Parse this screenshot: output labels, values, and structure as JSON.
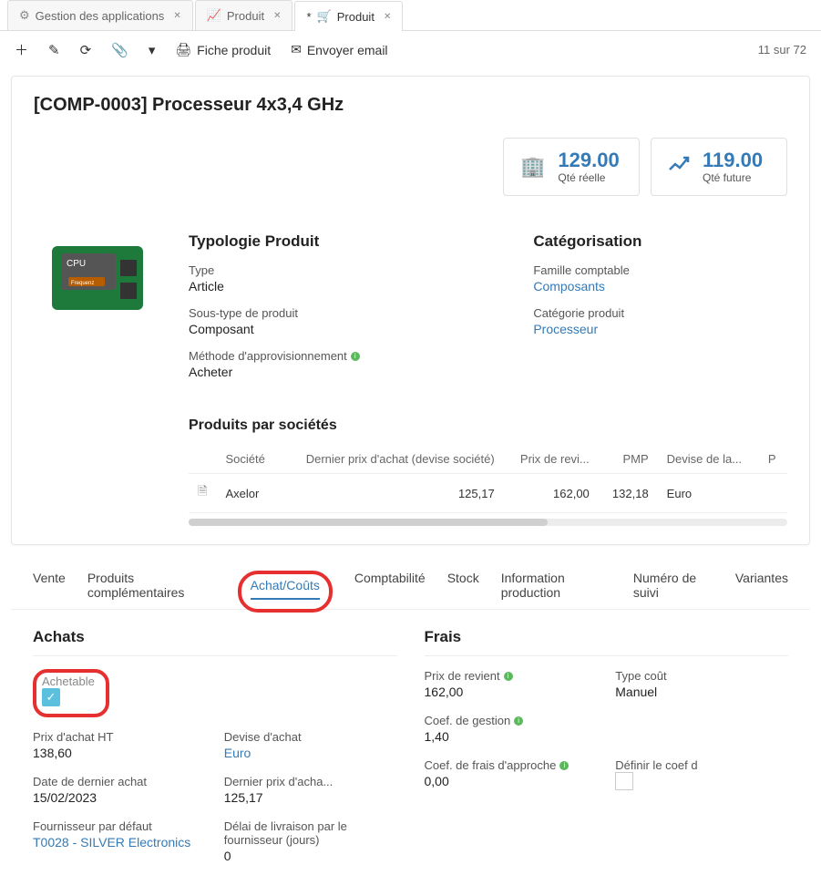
{
  "tabs": [
    {
      "icon": "gear",
      "label": "Gestion des applications"
    },
    {
      "icon": "chart",
      "label": "Produit"
    },
    {
      "icon": "cart",
      "label": "Produit",
      "active": true,
      "dirty": "*"
    }
  ],
  "toolbar": {
    "fiche_label": "Fiche produit",
    "email_label": "Envoyer email",
    "pager": "11 sur 72"
  },
  "header": {
    "title": "[COMP-0003] Processeur 4x3,4 GHz"
  },
  "kpis": [
    {
      "value": "129.00",
      "label": "Qté réelle",
      "icon": "building"
    },
    {
      "value": "119.00",
      "label": "Qté future",
      "icon": "trend"
    }
  ],
  "typologie": {
    "section": "Typologie Produit",
    "type_label": "Type",
    "type_value": "Article",
    "subtype_label": "Sous-type de produit",
    "subtype_value": "Composant",
    "method_label": "Méthode d'approvisionnement",
    "method_value": "Acheter"
  },
  "categorisation": {
    "section": "Catégorisation",
    "fam_label": "Famille comptable",
    "fam_value": "Composants",
    "cat_label": "Catégorie produit",
    "cat_value": "Processeur"
  },
  "company_table": {
    "title": "Produits par sociétés",
    "headers": [
      "Société",
      "Dernier prix d'achat (devise société)",
      "Prix de revi...",
      "PMP",
      "Devise de la...",
      "P"
    ],
    "row": {
      "societe": "Axelor",
      "dernier_prix": "125,17",
      "prix_revient": "162,00",
      "pmp": "132,18",
      "devise": "Euro"
    }
  },
  "subtabs": [
    "Vente",
    "Produits complémentaires",
    "Achat/Coûts",
    "Comptabilité",
    "Stock",
    "Information production",
    "Numéro de suivi",
    "Variantes"
  ],
  "achats": {
    "title": "Achats",
    "achetable_label": "Achetable",
    "prix_ht_label": "Prix d'achat HT",
    "prix_ht_value": "138,60",
    "devise_label": "Devise d'achat",
    "devise_value": "Euro",
    "date_label": "Date de dernier achat",
    "date_value": "15/02/2023",
    "dernier_prix_label": "Dernier prix d'acha...",
    "dernier_prix_value": "125,17",
    "fournisseur_label": "Fournisseur par défaut",
    "fournisseur_value": "T0028 - SILVER Electronics",
    "delai_label": "Délai de livraison par le fournisseur (jours)",
    "delai_value": "0"
  },
  "frais": {
    "title": "Frais",
    "prix_revient_label": "Prix de revient",
    "prix_revient_value": "162,00",
    "type_cout_label": "Type coût",
    "type_cout_value": "Manuel",
    "coef_gestion_label": "Coef. de gestion",
    "coef_gestion_value": "1,40",
    "coef_frais_label": "Coef. de frais d'approche",
    "coef_frais_value": "0,00",
    "definir_label": "Définir le coef d"
  }
}
